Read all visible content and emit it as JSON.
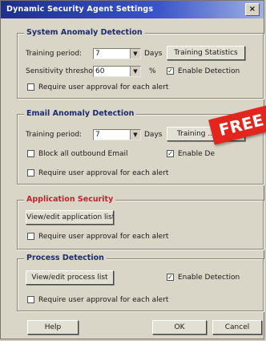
{
  "window": {
    "title": "Dynamic Security Agent Settings",
    "close_glyph": "×"
  },
  "system": {
    "title": "System Anomaly Detection",
    "training_label": "Training period:",
    "training_value": "7",
    "days_label": "Days",
    "training_button": "Training Statistics",
    "sensitivity_label": "Sensitivity threshold:",
    "sensitivity_value": "60",
    "percent_label": "%",
    "enable_label": "Enable Detection",
    "enable_checked": true,
    "approval_label": "Require user approval for each alert",
    "approval_checked": false
  },
  "email": {
    "title": "Email Anomaly Detection",
    "training_label": "Training period:",
    "training_value": "7",
    "days_label": "Days",
    "training_button": "Training ...",
    "block_label": "Block all outbound Email",
    "block_checked": false,
    "enable_label": "Enable De",
    "enable_checked": true,
    "approval_label": "Require user approval for each alert",
    "approval_checked": false
  },
  "application": {
    "title": "Application Security",
    "view_button": "View/edit application list",
    "approval_label": "Require user approval for each alert",
    "approval_checked": false
  },
  "process": {
    "title": "Process Detection",
    "view_button": "View/edit process list",
    "enable_label": "Enable Detection",
    "enable_checked": true,
    "approval_label": "Require user approval for each alert",
    "approval_checked": false
  },
  "banner": {
    "text": "FREE"
  },
  "footer": {
    "help": "Help",
    "ok": "OK",
    "cancel": "Cancel"
  },
  "glyphs": {
    "check": "✓",
    "dropdown": "▼"
  }
}
